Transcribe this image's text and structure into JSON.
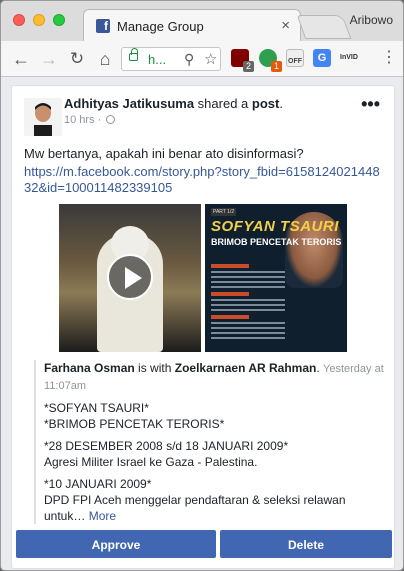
{
  "browser": {
    "tab_title": "Manage Group",
    "tab_close": "×",
    "profile_name": "Aribowo",
    "url_text": "h..."
  },
  "extensions": {
    "ublock_badge": "2",
    "green_badge": "1",
    "off_label": "OFF",
    "invid_label": "InVID"
  },
  "post": {
    "author": "Adhityas Jatikusuma",
    "shared_a": "shared a",
    "post_word": "post",
    "time": "10 hrs",
    "more": "•••",
    "text": "Mw bertanya, apakah ini benar ato disinformasi?",
    "link": "https://m.facebook.com/story.php?story_fbid=615812402144832&id=100011482339105"
  },
  "poster": {
    "tag": "PART 1/2",
    "title": "SOFYAN TSAURI",
    "subtitle": "BRIMOB PENCETAK TERORIS"
  },
  "shared": {
    "author": "Farhana Osman",
    "is_with": "is with",
    "with_name": "Zoelkarnaen AR Rahman",
    "time": "Yesterday at 11:07am",
    "p1_line1": "*SOFYAN TSAURI*",
    "p1_line2": "*BRIMOB PENCETAK TERORIS*",
    "p2_line1": "*28 DESEMBER 2008 s/d 18 JANUARI 2009*",
    "p2_line2": "Agresi Militer Israel ke Gaza - Palestina.",
    "p3_line1": "*10 JANUARI 2009*",
    "p3_line2": "DPD FPI Aceh menggelar pendaftaran & seleksi relawan untuk…",
    "more": "More"
  },
  "actions": {
    "approve": "Approve",
    "delete": "Delete"
  },
  "colors": {
    "facebook_blue": "#4267b2",
    "link_blue": "#365899",
    "secure_green": "#1e8e3e"
  }
}
